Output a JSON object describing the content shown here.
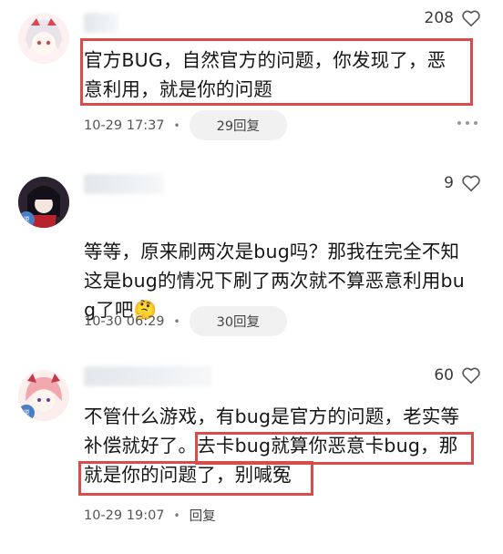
{
  "comments": [
    {
      "likes": "208",
      "text": "官方BUG，自然官方的问题，你发现了，恶\n意利用，就是你的问题",
      "timestamp": "10-29 17:37",
      "reply_label": "29回复"
    },
    {
      "likes": "9",
      "text": "等等，原来刷两次是bug吗？那我在完全不知\n这是bug的情况下刷了两次就不算恶意利用bu\ng了吧",
      "emoji": "🤔",
      "timestamp": "10-30 06:29",
      "reply_label": "30回复"
    },
    {
      "likes": "60",
      "text": "不管什么游戏，有bug是官方的问题，老实等\n补偿就好了。去卡bug就算你恶意卡bug，那\n就是你的问题了，别喊冤",
      "timestamp": "10-29 19:07",
      "reply_label": "回复"
    }
  ],
  "colors": {
    "highlight": "#d94c4c",
    "pill_bg": "#f1f1f1",
    "meta_text": "#555555"
  },
  "icons": {
    "like": "heart-outline-icon",
    "more": "more-dots-icon",
    "separator": "dot-separator"
  }
}
